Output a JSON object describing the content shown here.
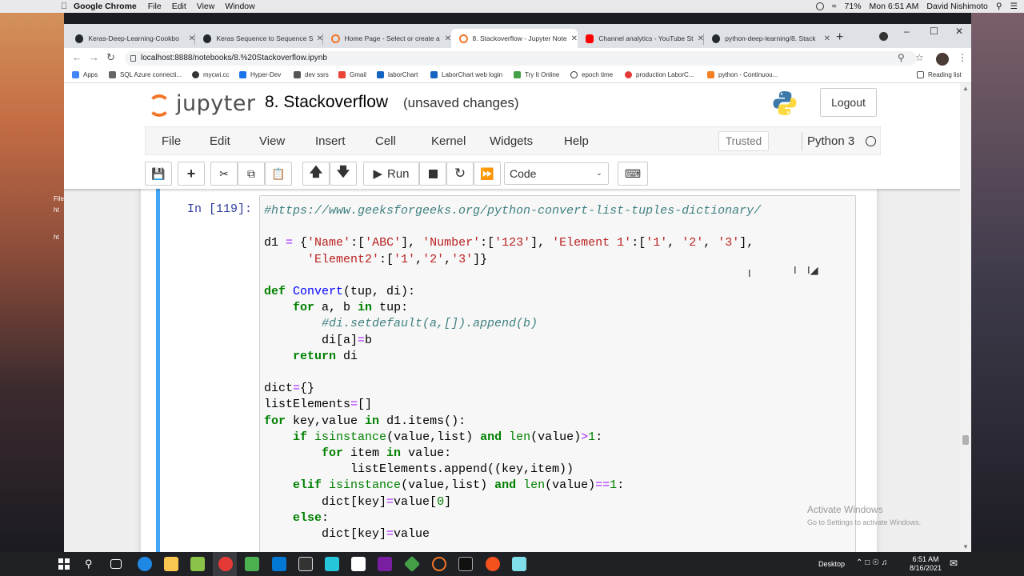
{
  "mac_menubar": {
    "app_name": "Google Chrome",
    "menus": [
      "File",
      "Edit",
      "View",
      "Window"
    ],
    "battery": "71%",
    "datetime": "Mon 6:51 AM",
    "user": "David Nishimoto"
  },
  "desktop": {
    "file_label": "File",
    "items": [
      "ht",
      "ht"
    ]
  },
  "browser": {
    "tabs": [
      {
        "label": "Keras-Deep-Learning-Cookbo",
        "icon": "github-icon"
      },
      {
        "label": "Keras Sequence to Sequence S",
        "icon": "github-icon"
      },
      {
        "label": "Home Page - Select or create a",
        "icon": "jupyter-icon"
      },
      {
        "label": "8. Stackoverflow - Jupyter Note",
        "icon": "jupyter-icon",
        "active": true
      },
      {
        "label": "Channel analytics - YouTube St",
        "icon": "youtube-icon"
      },
      {
        "label": "python-deep-learning/8. Stack",
        "icon": "github-icon"
      }
    ],
    "url": "localhost:8888/notebooks/8.%20Stackoverflow.ipynb",
    "bookmarks": [
      "Apps",
      "SQL Azure connecti...",
      "mycwi.cc",
      "Hyper-Dev",
      "dev ssrs",
      "Gmail",
      "laborChart",
      "LaborChart web login",
      "Try It Online",
      "epoch time",
      "production LaborC...",
      "python - Continuou..."
    ],
    "reading_list": "Reading list"
  },
  "jupyter": {
    "logo_text": "jupyter",
    "notebook_title": "8. Stackoverflow",
    "save_status": "(unsaved changes)",
    "logout_label": "Logout",
    "menu": [
      "File",
      "Edit",
      "View",
      "Insert",
      "Cell",
      "Kernel",
      "Widgets",
      "Help"
    ],
    "trusted_label": "Trusted",
    "kernel_name": "Python 3",
    "toolbar": {
      "run_label": "Run",
      "cell_type": "Code"
    },
    "cell": {
      "prompt": "In [119]:",
      "code_lines": [
        "#https://www.geeksforgeeks.org/python-convert-list-tuples-dictionary/",
        "",
        "d1 = {'Name':['ABC'], 'Number':['123'], 'Element 1':['1', '2', '3'],",
        "      'Element2':['1','2','3']}",
        "",
        "def Convert(tup, di):",
        "    for a, b in tup:",
        "        #di.setdefault(a,[]).append(b)",
        "        di[a]=b",
        "    return di",
        "",
        "dict={}",
        "listElements=[]",
        "for key,value in d1.items():",
        "    if isinstance(value,list) and len(value)>1:",
        "        for item in value:",
        "            listElements.append((key,item))",
        "    elif isinstance(value,list) and len(value)==1:",
        "        dict[key]=value[0]",
        "    else:",
        "        dict[key]=value"
      ]
    }
  },
  "watermark": {
    "title": "Activate Windows",
    "subtitle": "Go to Settings to activate Windows."
  },
  "taskbar": {
    "desktop_label": "Desktop",
    "time": "6:51 AM",
    "date": "8/16/2021"
  }
}
